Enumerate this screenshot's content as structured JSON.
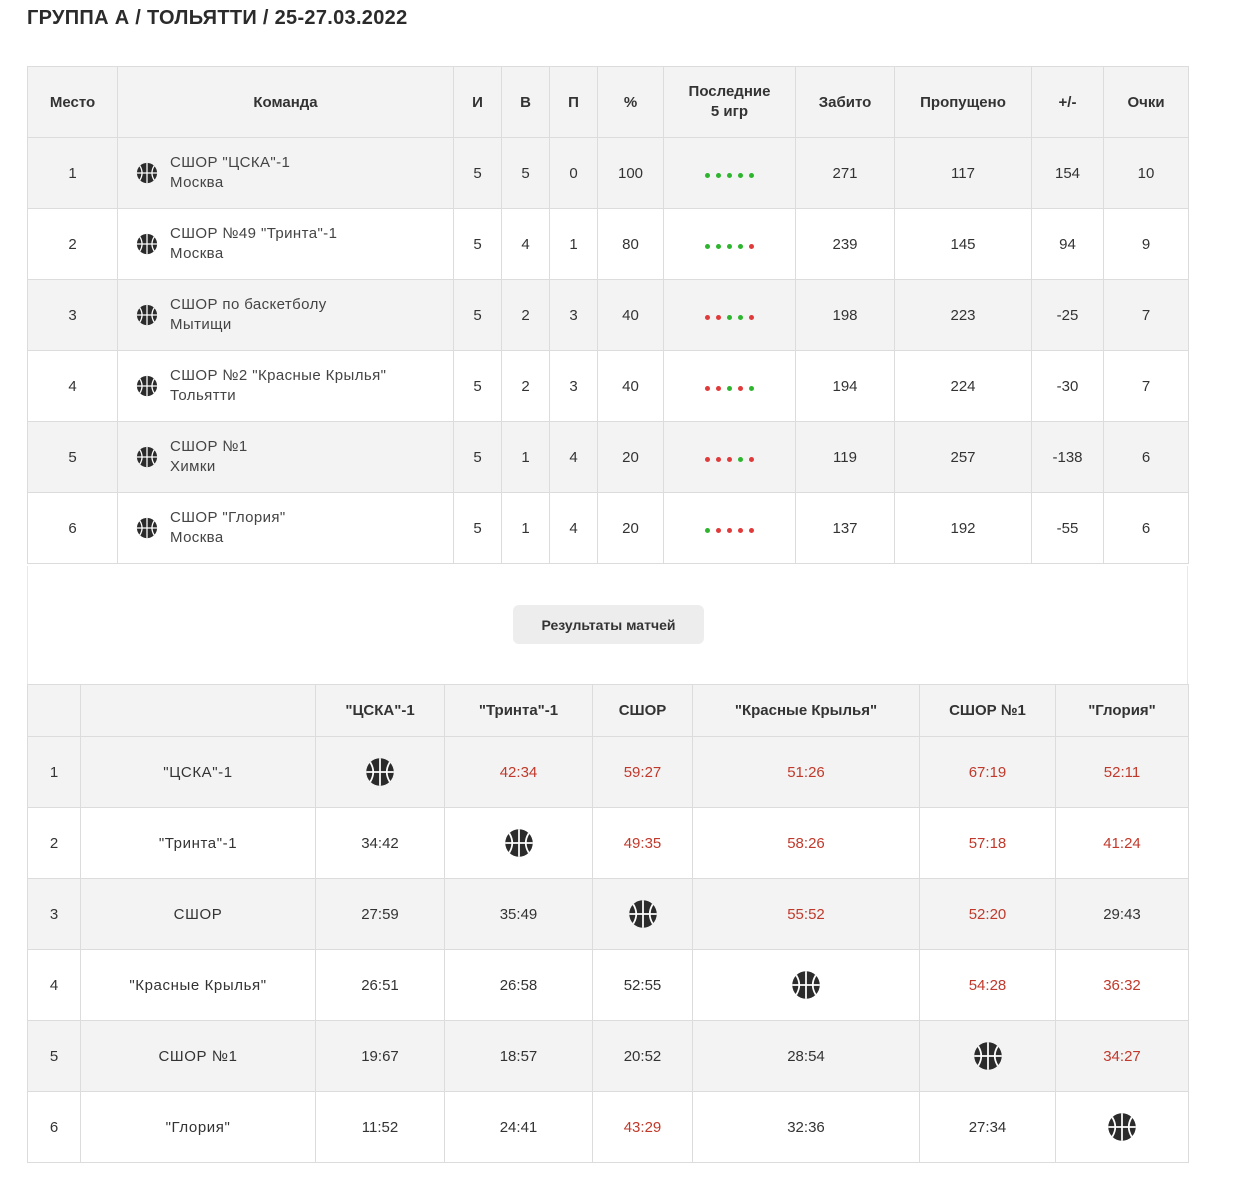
{
  "page_title": "ГРУППА А / ТОЛЬЯТТИ / 25-27.03.2022",
  "colors": {
    "win": "#2db52d",
    "loss": "#e03a3a",
    "score_win_text": "#c0392b"
  },
  "icons": {
    "team_logo": "basketball-icon"
  },
  "standings": {
    "headers": [
      "Место",
      "Команда",
      "И",
      "В",
      "П",
      "%",
      "Последние\n5 игр",
      "Забито",
      "Пропущено",
      "+/-",
      "Очки"
    ],
    "rows": [
      {
        "place": "1",
        "name": "СШОР \"ЦСКА\"-1",
        "city": "Москва",
        "games": "5",
        "wins": "5",
        "losses": "0",
        "pct": "100",
        "last5": [
          "W",
          "W",
          "W",
          "W",
          "W"
        ],
        "scored": "271",
        "conceded": "117",
        "diff": "154",
        "points": "10"
      },
      {
        "place": "2",
        "name": "СШОР №49 \"Тринта\"-1",
        "city": "Москва",
        "games": "5",
        "wins": "4",
        "losses": "1",
        "pct": "80",
        "last5": [
          "W",
          "W",
          "W",
          "W",
          "L"
        ],
        "scored": "239",
        "conceded": "145",
        "diff": "94",
        "points": "9"
      },
      {
        "place": "3",
        "name": "СШОР по баскетболу",
        "city": "Мытищи",
        "games": "5",
        "wins": "2",
        "losses": "3",
        "pct": "40",
        "last5": [
          "L",
          "L",
          "W",
          "W",
          "L"
        ],
        "scored": "198",
        "conceded": "223",
        "diff": "-25",
        "points": "7"
      },
      {
        "place": "4",
        "name": "СШОР №2 \"Красные Крылья\"",
        "city": "Тольятти",
        "games": "5",
        "wins": "2",
        "losses": "3",
        "pct": "40",
        "last5": [
          "L",
          "L",
          "W",
          "L",
          "W"
        ],
        "scored": "194",
        "conceded": "224",
        "diff": "-30",
        "points": "7"
      },
      {
        "place": "5",
        "name": "СШОР №1",
        "city": "Химки",
        "games": "5",
        "wins": "1",
        "losses": "4",
        "pct": "20",
        "last5": [
          "L",
          "L",
          "L",
          "W",
          "L"
        ],
        "scored": "119",
        "conceded": "257",
        "diff": "-138",
        "points": "6"
      },
      {
        "place": "6",
        "name": "СШОР \"Глория\"",
        "city": "Москва",
        "games": "5",
        "wins": "1",
        "losses": "4",
        "pct": "20",
        "last5": [
          "W",
          "L",
          "L",
          "L",
          "L"
        ],
        "scored": "137",
        "conceded": "192",
        "diff": "-55",
        "points": "6"
      }
    ]
  },
  "results_button_label": "Результаты матчей",
  "matrix": {
    "headers": [
      "\"ЦСКА\"-1",
      "\"Тринта\"-1",
      "СШОР",
      "\"Красные Крылья\"",
      "СШОР №1",
      "\"Глория\""
    ],
    "rows": [
      {
        "num": "1",
        "name": "\"ЦСКА\"-1",
        "cells": [
          null,
          "42:34",
          "59:27",
          "51:26",
          "67:19",
          "52:11"
        ]
      },
      {
        "num": "2",
        "name": "\"Тринта\"-1",
        "cells": [
          "34:42",
          null,
          "49:35",
          "58:26",
          "57:18",
          "41:24"
        ]
      },
      {
        "num": "3",
        "name": "СШОР",
        "cells": [
          "27:59",
          "35:49",
          null,
          "55:52",
          "52:20",
          "29:43"
        ]
      },
      {
        "num": "4",
        "name": "\"Красные Крылья\"",
        "cells": [
          "26:51",
          "26:58",
          "52:55",
          null,
          "54:28",
          "36:32"
        ]
      },
      {
        "num": "5",
        "name": "СШОР №1",
        "cells": [
          "19:67",
          "18:57",
          "20:52",
          "28:54",
          null,
          "34:27"
        ]
      },
      {
        "num": "6",
        "name": "\"Глория\"",
        "cells": [
          "11:52",
          "24:41",
          "43:29",
          "32:36",
          "27:34",
          null
        ]
      }
    ]
  }
}
